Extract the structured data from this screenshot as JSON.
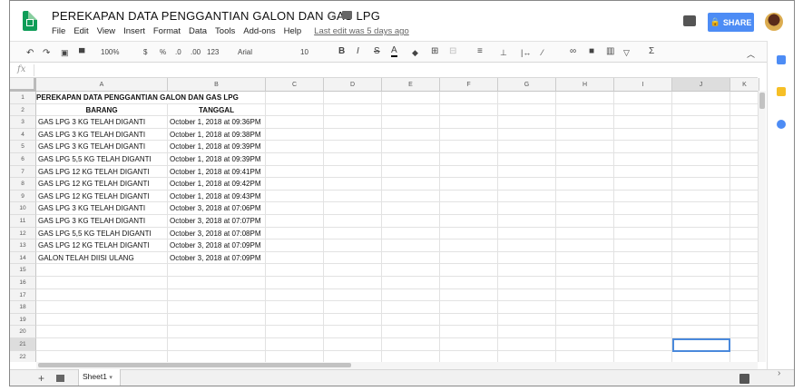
{
  "doc": {
    "title": "PEREKAPAN DATA PENGGANTIAN GALON DAN GAS LPG",
    "last_edit": "Last edit was 5 days ago",
    "share_label": "SHARE"
  },
  "menu": [
    "File",
    "Edit",
    "View",
    "Insert",
    "Format",
    "Data",
    "Tools",
    "Add-ons",
    "Help"
  ],
  "toolbar": {
    "zoom": "100%",
    "currency": "$",
    "percent": "%",
    "dec_less": ".0",
    "dec_more": ".00",
    "more_formats": "123",
    "font": "Arial",
    "font_size": "10",
    "bold": "B",
    "italic": "I",
    "strike": "S",
    "text_color": "A",
    "sum": "Σ"
  },
  "formula_bar": {
    "fx": "fx",
    "value": ""
  },
  "columns": [
    "A",
    "B",
    "C",
    "D",
    "E",
    "F",
    "G",
    "H",
    "I",
    "J",
    "K"
  ],
  "rows": [
    [
      "PEREKAPAN DATA PENGGANTIAN GALON DAN GAS LPG",
      ""
    ],
    [
      "BARANG",
      "TANGGAL"
    ],
    [
      "GAS LPG 3 KG TELAH DIGANTI",
      "October 1, 2018 at 09:36PM"
    ],
    [
      "GAS LPG 3 KG TELAH DIGANTI",
      "October 1, 2018 at 09:38PM"
    ],
    [
      "GAS LPG 3 KG TELAH DIGANTI",
      "October 1, 2018 at 09:39PM"
    ],
    [
      "GAS LPG 5,5 KG TELAH DIGANTI",
      "October 1, 2018 at 09:39PM"
    ],
    [
      "GAS LPG 12 KG TELAH DIGANTI",
      "October 1, 2018 at 09:41PM"
    ],
    [
      "GAS LPG 12 KG TELAH DIGANTI",
      "October 1, 2018 at 09:42PM"
    ],
    [
      "GAS LPG 12 KG TELAH DIGANTI",
      "October 1, 2018 at 09:43PM"
    ],
    [
      "GAS LPG 3 KG TELAH DIGANTI",
      "October 3, 2018 at 07:06PM"
    ],
    [
      "GAS LPG 3 KG TELAH DIGANTI",
      "October 3, 2018 at 07:07PM"
    ],
    [
      "GAS LPG 5,5 KG TELAH DIGANTI",
      "October 3, 2018 at 07:08PM"
    ],
    [
      "GAS LPG 12 KG TELAH DIGANTI",
      "October 3, 2018 at 07:09PM"
    ],
    [
      "GALON TELAH DIISI ULANG",
      "October 3, 2018 at 07:09PM"
    ],
    [
      "",
      ""
    ],
    [
      "",
      ""
    ],
    [
      "",
      ""
    ],
    [
      "",
      ""
    ],
    [
      "",
      ""
    ],
    [
      "",
      ""
    ],
    [
      "",
      ""
    ],
    [
      "",
      ""
    ]
  ],
  "row_numbers": [
    "1",
    "2",
    "3",
    "4",
    "5",
    "6",
    "7",
    "8",
    "9",
    "10",
    "11",
    "12",
    "13",
    "14",
    "15",
    "16",
    "17",
    "18",
    "19",
    "20",
    "21",
    "22"
  ],
  "selected_cell": "J21",
  "sheet": {
    "add": "+",
    "tab_label": "Sheet1",
    "tab_arrow": "▾"
  },
  "colors": {
    "accent": "#4d8cf5",
    "sheets_green": "#0f9d58",
    "selection": "#4a89dc"
  }
}
